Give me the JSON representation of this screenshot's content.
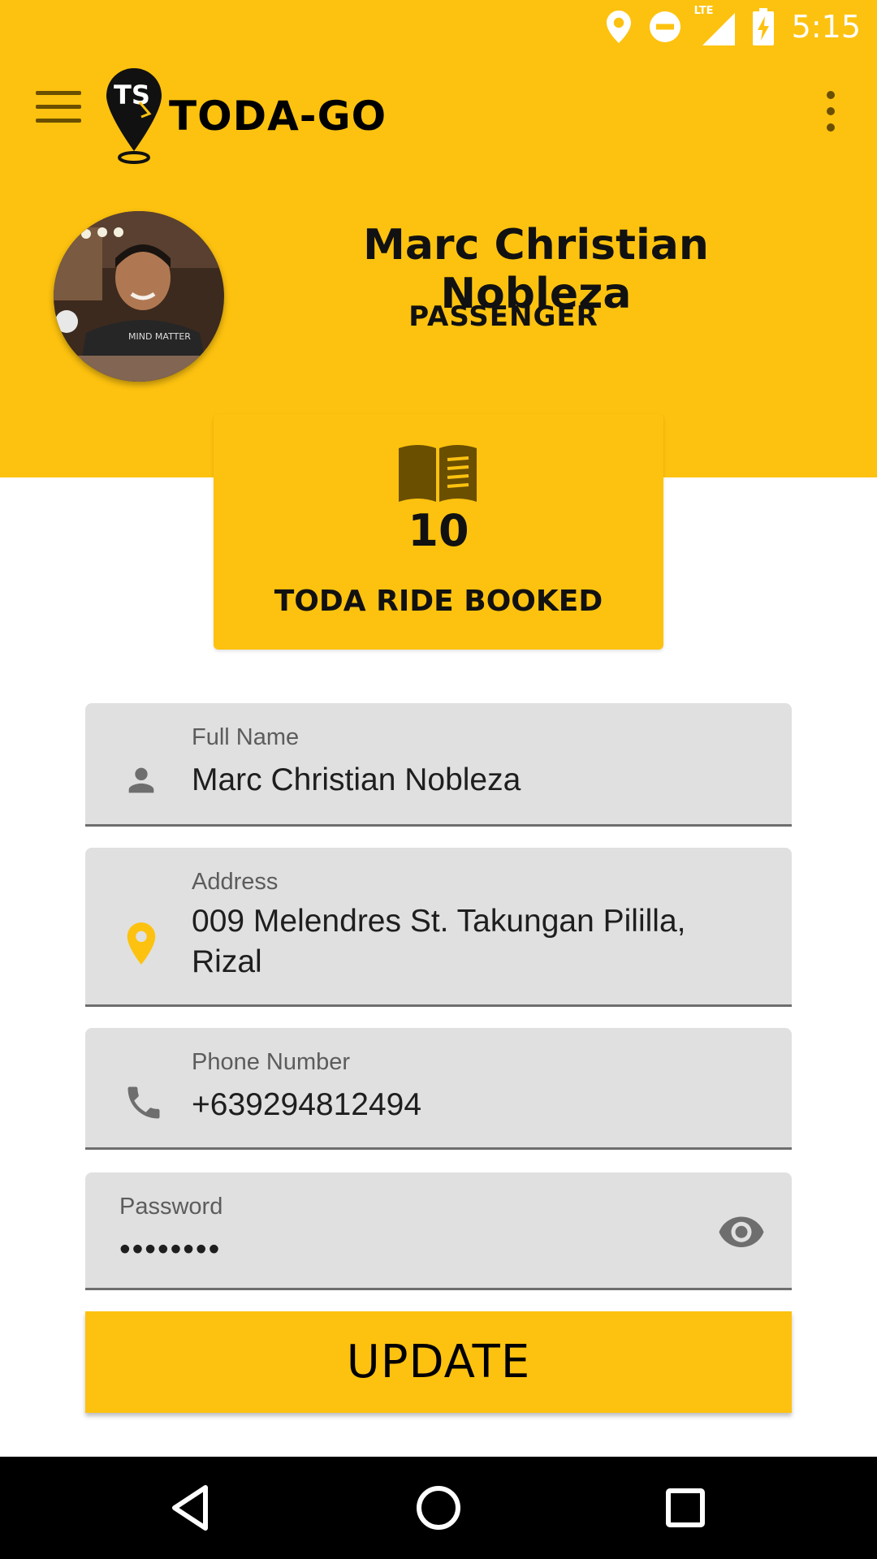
{
  "status_bar": {
    "time": "5:15",
    "network_label": "LTE",
    "icons": [
      "location-icon",
      "do-not-disturb-icon",
      "lte-signal-icon",
      "battery-charging-icon"
    ]
  },
  "app_bar": {
    "logo_text": "TODA-GO",
    "logo_mark": "TS",
    "menu_icon": "hamburger-menu-icon",
    "overflow_icon": "more-vertical-icon"
  },
  "profile": {
    "name": "Marc Christian Nobleza",
    "role": "PASSENGER",
    "avatar_shirt_text": "MIND MATTER"
  },
  "rides": {
    "icon": "open-book-icon",
    "count": "10",
    "label": "TODA RIDE BOOKED"
  },
  "form": {
    "full_name": {
      "label": "Full Name",
      "value": "Marc Christian Nobleza",
      "icon": "person-icon"
    },
    "address": {
      "label": "Address",
      "value_line1": "009 Melendres St. Takungan Pililla,",
      "value_line2": "Rizal",
      "icon": "location-pin-icon"
    },
    "phone": {
      "label": "Phone Number",
      "value": "+639294812494",
      "icon": "phone-icon"
    },
    "password": {
      "label": "Password",
      "value": "••••••••",
      "icon": "visibility-eye-icon"
    }
  },
  "update_button": {
    "label": "UPDATE"
  },
  "nav_bar": {
    "icons": [
      "back-triangle-icon",
      "home-circle-icon",
      "recents-square-icon"
    ]
  },
  "colors": {
    "accent": "#FDC20F",
    "field_bg": "#E0E0E0",
    "dark_icon": "#6b4f00",
    "nav_bg": "#000000"
  }
}
